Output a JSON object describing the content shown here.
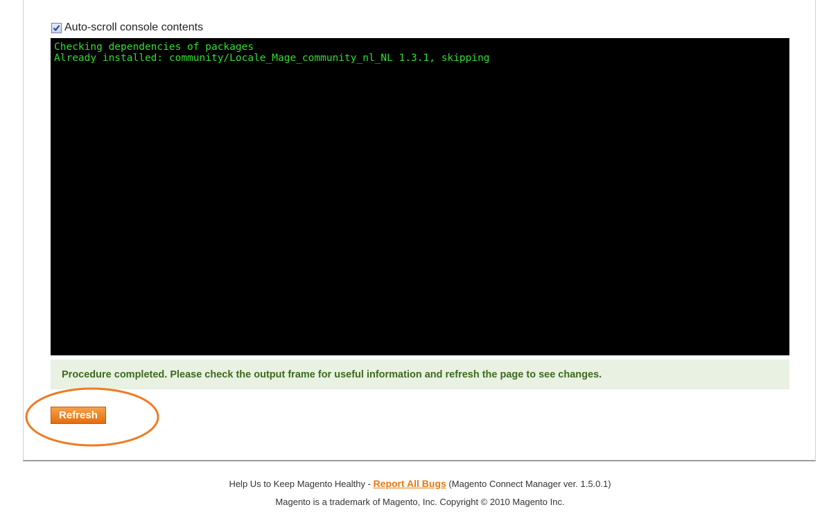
{
  "options": {
    "autoscroll_label": "Auto-scroll console contents",
    "autoscroll_checked": true
  },
  "console": {
    "lines": [
      "Checking dependencies of packages",
      "Already installed: community/Locale_Mage_community_nl_NL 1.3.1, skipping"
    ],
    "text_color": "#33dd33",
    "background_color": "#000000"
  },
  "notice": {
    "text": "Procedure completed. Please check the output frame for useful information and refresh the page to see changes.",
    "text_color": "#3c6a1f",
    "background_color": "#e9f1e2"
  },
  "actions": {
    "refresh_label": "Refresh",
    "button_color": "#e56d0b",
    "highlight_color": "#ef7b22"
  },
  "footer": {
    "prefix": "Help Us to Keep Magento Healthy - ",
    "report_link": "Report All Bugs",
    "version_text": " (Magento Connect Manager ver. 1.5.0.1)",
    "copyright": "Magento is a trademark of Magento, Inc. Copyright © 2010 Magento Inc."
  }
}
